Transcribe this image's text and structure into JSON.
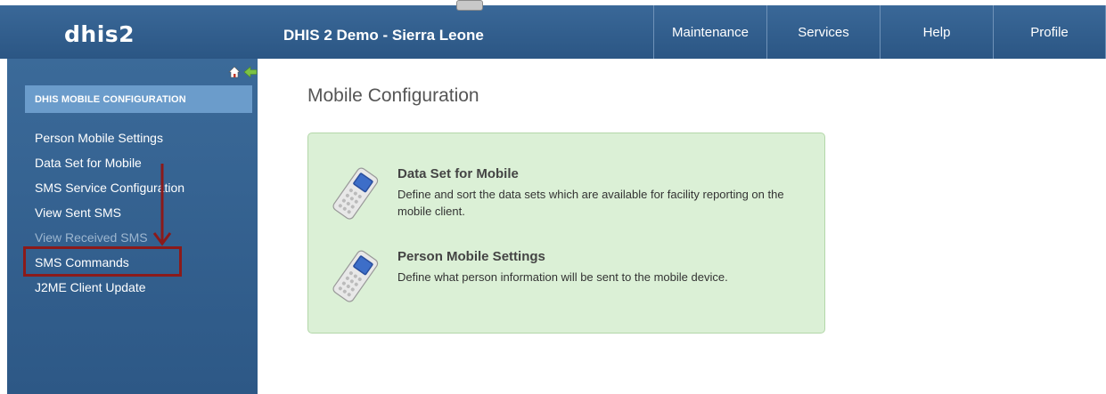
{
  "header": {
    "logo": "dhis2",
    "site_title": "DHIS 2 Demo - Sierra Leone",
    "nav": [
      "Maintenance",
      "Services",
      "Help",
      "Profile"
    ]
  },
  "sidebar": {
    "section_title": "DHIS MOBILE CONFIGURATION",
    "items": [
      {
        "label": "Person Mobile Settings"
      },
      {
        "label": "Data Set for Mobile"
      },
      {
        "label": "SMS Service Configuration"
      },
      {
        "label": "View Sent SMS"
      },
      {
        "label": "View Received SMS"
      },
      {
        "label": "SMS Commands"
      },
      {
        "label": "J2ME Client Update"
      }
    ]
  },
  "main": {
    "page_title": "Mobile Configuration",
    "cards": [
      {
        "title": "Data Set for Mobile",
        "description": "Define and sort the data sets which are available for facility reporting on the mobile client."
      },
      {
        "title": "Person Mobile Settings",
        "description": "Define what person information will be sent to the mobile device."
      }
    ]
  },
  "icons": {
    "home": "home-icon",
    "back": "back-arrow-icon",
    "phone": "mobile-phone-icon"
  },
  "colors": {
    "header_bg": "#2b5684",
    "sidebar_bg": "#2d5886",
    "section_box": "#6b9ccb",
    "panel_bg": "#dbf0d6",
    "annotation": "#8b1a1a"
  }
}
